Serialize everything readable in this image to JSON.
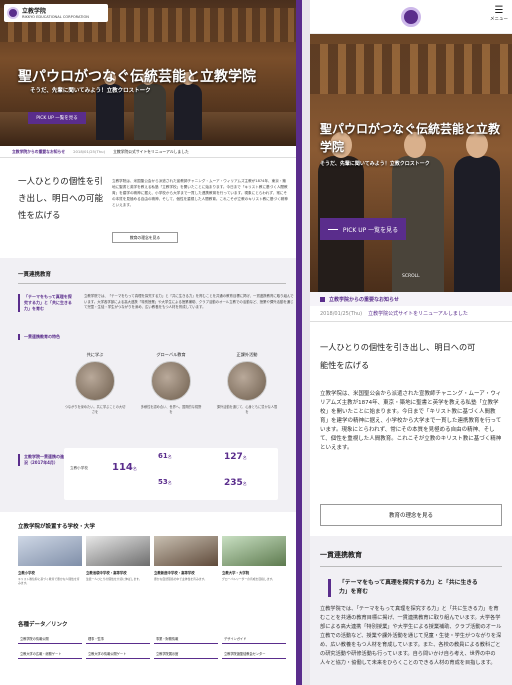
{
  "desktop": {
    "logo": {
      "name": "立教学院",
      "en": "RIKKYO EDUCATIONAL CORPORATION"
    },
    "hero": {
      "title": "聖パウロがつなぐ伝統芸能と立教学院",
      "subtitle": "そうだ、先輩に聞いてみよう！立教クロストーク",
      "pick_label": "PICK UP 一覧を見る"
    },
    "news": {
      "label": "立教学院からの重要なお知らせ",
      "date": "2018/01/25(Thu)",
      "text": "立教学院公式サイトをリニューアルしました"
    },
    "intro": {
      "heading": "一人ひとりの個性を引き出し、明日への可能性を広げる",
      "body": "立教学院は、米国聖公会から派遣された宣教師チャニング・ムーア・ウィリアムズ主教が1874年、東京・築地に聖書と英学を教える私塾「立教学校」を開いたことに始まります。今日まで「キリスト教に基づく人間教育」を建学の精神に据え、小学校から大学まで一貫した連携教育を行っています。現象にとらわれず、常にその本質を見極める自由の精神、そして、個性を重視した人間教育。これこそが立教のキリスト教に基づく精神といえます。",
      "button": "教育の理念を見る"
    },
    "ikkan": {
      "title": "一貫連携教育",
      "row1_side": "「テーマをもって真理を探究する力」と「共に生きる力」を育む",
      "row1_body": "立教学院では、「テーマをもって真理を探究する力」と「共に生きる力」を育むことを共通の教育目標に掲げ、一貫連携教育に取り組んでいます。大学各学部による高大連携「特別授業」や大学生による授業補助、クラブ活動のオール立教での活動など、授業や課外活動を通じて児童・生徒・学生がつながりを深め、広い教養をもつ人材を育成しています。",
      "row2_side": "一貫連携教育の特色",
      "circles": [
        {
          "cap": "共に学ぶ",
          "txt": "つながりを深めたい。共に学ぶことの大切さを"
        },
        {
          "cap": "グローバル教育",
          "txt": "多様性を認め合い、世界へ。国際的な視野を"
        },
        {
          "cap": "正課外活動",
          "txt": "課外活動を通じて、心身ともに豊かな人間を"
        }
      ],
      "row3_side": "立教学院一貫連携の進学状況（2017年4月）",
      "stats": {
        "label": "立教小学校",
        "n1": "114",
        "n1u": "名",
        "n2": "61",
        "n2u": "名",
        "n3": "53",
        "n3u": "名",
        "n4": "127",
        "n4u": "名",
        "n5": "235",
        "n5u": "名"
      }
    },
    "schools": {
      "title": "立教学院が設置する学校・大学",
      "items": [
        {
          "name": "立教小学校",
          "desc": "キリスト教信仰に基づく教育で豊かな人間性を育みます。"
        },
        {
          "name": "立教池袋中学校・高等学校",
          "desc": "生徒一人ひとりの個性を大切に伸ばします。"
        },
        {
          "name": "立教新座中学校・高等学校",
          "desc": "豊かな自然環境の中で主体性を育みます。"
        },
        {
          "name": "立教大学・大学院",
          "desc": "グローバルリーダーの育成を目指します。"
        }
      ]
    },
    "links": {
      "title": "各種データ／リンク",
      "items": [
        "立教学院の情報公開",
        "理事・監事",
        "事業・財務情報",
        "デザインガイド",
        "立教大学の広報・総務ゲート",
        "立教大学の情報公開ゲート",
        "立教学院展示館",
        "立教学院諸聖徒教会センター"
      ]
    }
  },
  "mobile": {
    "menu_label": "メニュー",
    "hero": {
      "title": "聖パウロがつなぐ伝統芸能と立教学院",
      "subtitle": "そうだ、先輩に聞いてみよう！立教クロストーク",
      "pick_label": "PICK UP 一覧を見る",
      "scroll": "SCROLL"
    },
    "notice": "立教学院からの重要なお知らせ",
    "news": {
      "date": "2018/01/25(Thu)",
      "text": "立教学院公式サイトをリニューアルしました"
    },
    "intro": {
      "heading": "一人ひとりの個性を引き出し、明日への可能性を広げる",
      "body": "立教学院は、米国聖公会から派遣された宣教師チャニング・ムーア・ウィリアムズ主教が1874年、東京・築地に聖書と英学を教える私塾「立教学校」を開いたことに始まります。今日まで「キリスト教に基づく人間教育」を建学の精神に据え、小学校から大学まで一貫した連携教育を行っています。現象にとらわれず、常にその本質を見極める自由の精神、そして、個性を重視した人間教育。これこそが立教のキリスト教に基づく精神といえます。",
      "button": "教育の理念を見る"
    },
    "ikkan": {
      "title": "一貫連携教育",
      "tag": "「テーマをもって真理を探究する力」と「共に生きる力」を育む",
      "body": "立教学院では、「テーマをもって真理を探究する力」と「共に生きる力」を育むことを共通の教育目標に掲げ、一貫連携教育に取り組んでいます。大学各学部による高大連携「特別授業」や大学生による授業補助、クラブ活動のオール立教での活動など、授業や課外活動を通じて児童・生徒・学生がつながりを深め、広い教養をもつ人材を育成しています。また、各校の教員による教科ごとの研究活動や研修活動も行っています。自ら問いかけ自ら考え、世界の中の人々と協力・協働して未来をひらくことのできる人材の育成を目指します。"
    }
  },
  "colors": {
    "accent": "#5a2d8c"
  }
}
